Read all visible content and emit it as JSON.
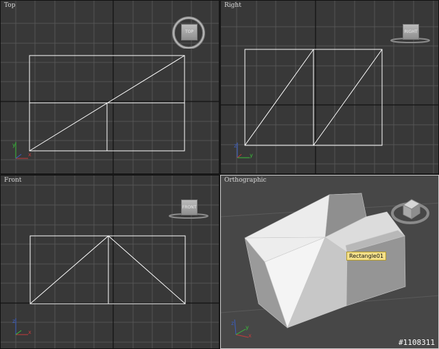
{
  "viewports": {
    "top": {
      "label": "Top",
      "cube_label": "TOP"
    },
    "right": {
      "label": "Right",
      "cube_label": "RIGHT"
    },
    "front": {
      "label": "Front",
      "cube_label": "FRONT"
    },
    "persp": {
      "label": "Orthographic",
      "cube_label": ""
    }
  },
  "selection_tooltip": "Rectangle01",
  "watermark": "#1108311",
  "colors": {
    "viewport_bg": "#383838",
    "active_viewport_bg": "#474747",
    "grid": "#555555",
    "wireframe": "#ffffff",
    "tooltip": "#f4e08a",
    "axis_x": "#c43b3b",
    "axis_y": "#3bbf3b",
    "axis_z": "#3b5fc4"
  },
  "icons": [
    "viewcube-icon",
    "axis-tripod-icon"
  ]
}
